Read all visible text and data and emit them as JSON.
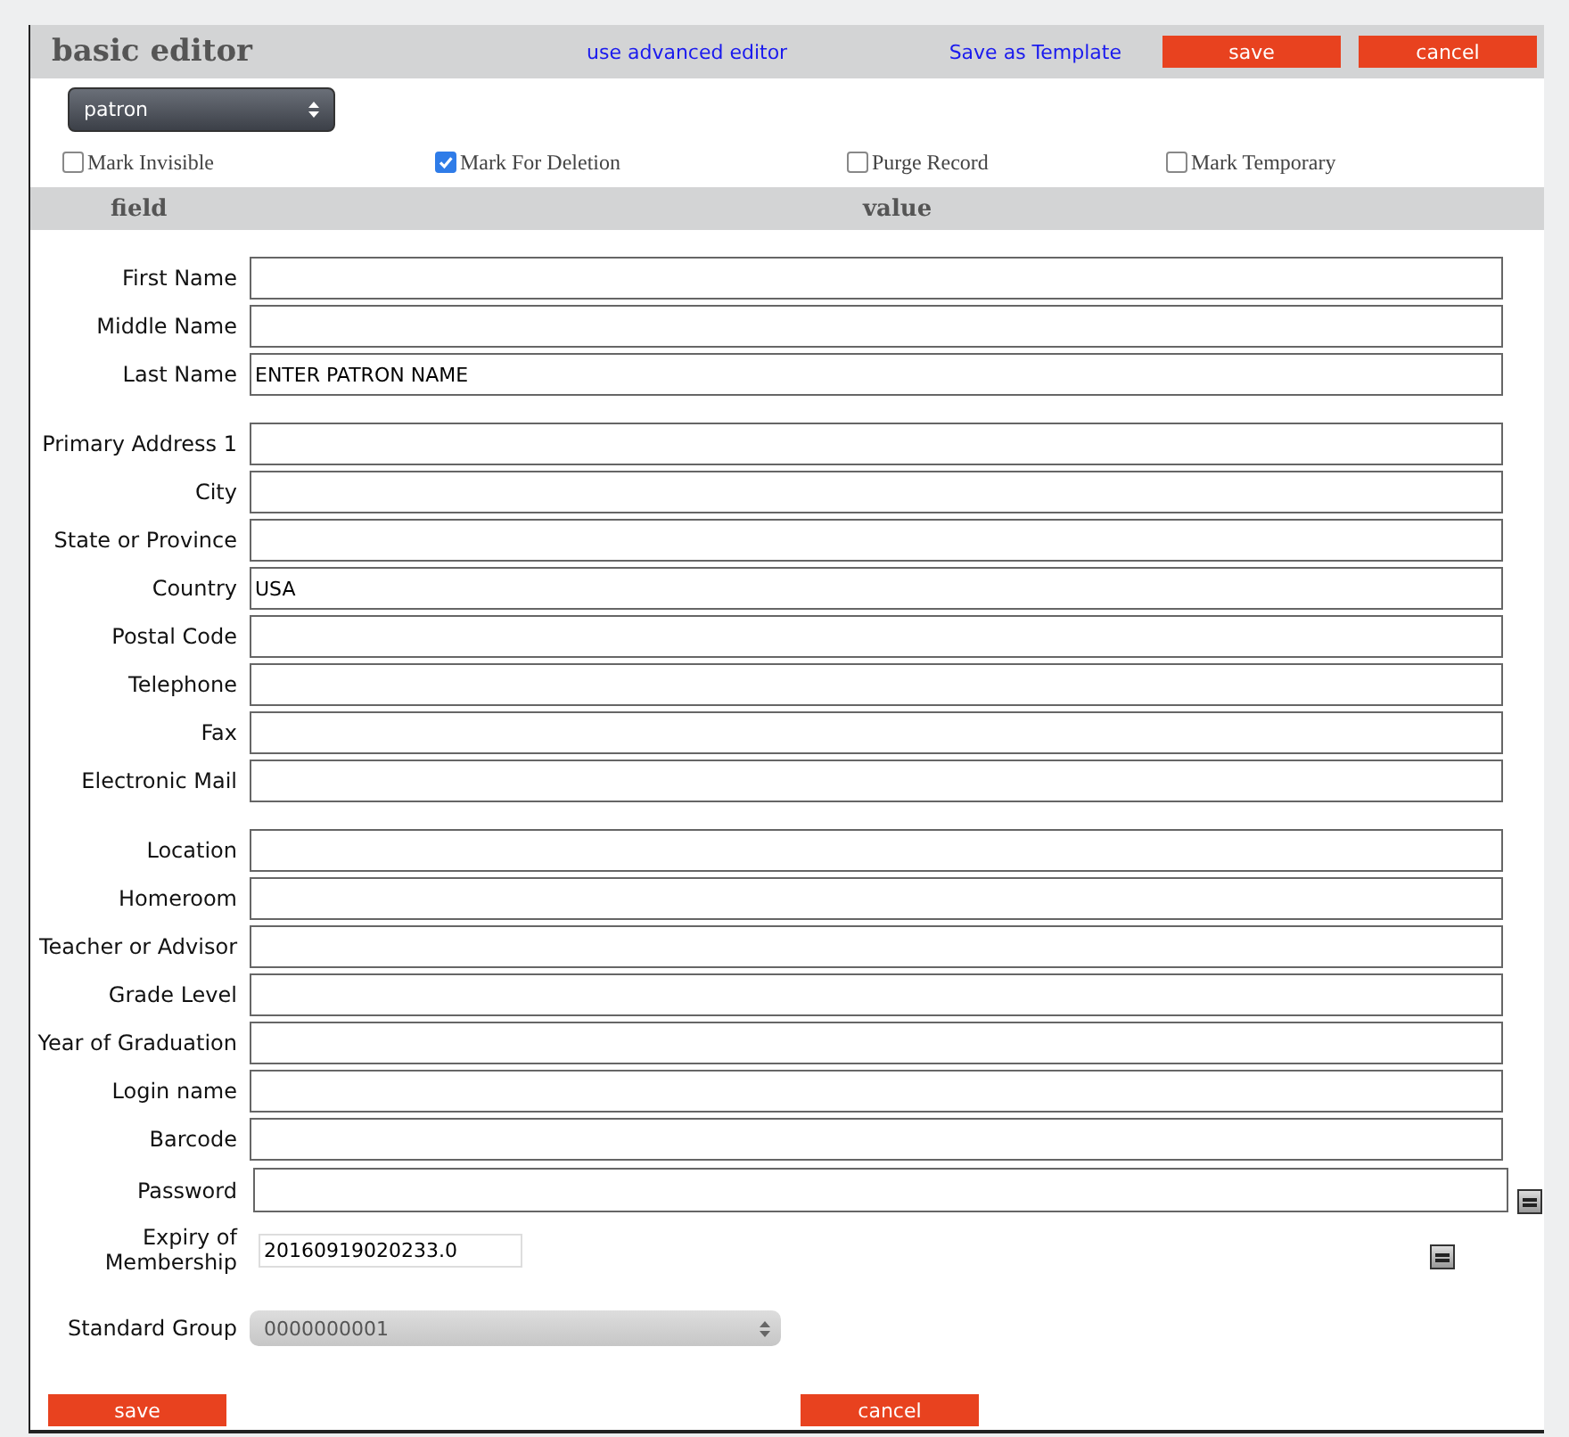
{
  "header": {
    "title": "basic editor",
    "advanced_link": "use advanced editor",
    "template_link": "Save as Template",
    "save": "save",
    "cancel": "cancel"
  },
  "record_type": "patron",
  "flags": [
    {
      "label": "Mark Invisible",
      "checked": false
    },
    {
      "label": "Mark For Deletion",
      "checked": true
    },
    {
      "label": "Purge Record",
      "checked": false
    },
    {
      "label": "Mark Temporary",
      "checked": false
    }
  ],
  "columns": [
    "field",
    "value"
  ],
  "groups": [
    [
      {
        "label": "First Name",
        "kind": "text"
      },
      {
        "label": "Middle Name",
        "kind": "text"
      },
      {
        "label": "Last Name",
        "kind": "text",
        "value": "ENTER PATRON NAME"
      }
    ],
    [
      {
        "label": "Primary Address 1",
        "kind": "text"
      },
      {
        "label": "City",
        "kind": "text"
      },
      {
        "label": "State or Province",
        "kind": "text"
      },
      {
        "label": "Country",
        "kind": "text",
        "value": "USA"
      },
      {
        "label": "Postal Code",
        "kind": "text"
      },
      {
        "label": "Telephone",
        "kind": "text"
      },
      {
        "label": "Fax",
        "kind": "text"
      },
      {
        "label": "Electronic Mail",
        "kind": "text"
      }
    ],
    [
      {
        "label": "Location",
        "kind": "text"
      },
      {
        "label": "Homeroom",
        "kind": "text"
      },
      {
        "label": "Teacher or Advisor",
        "kind": "text"
      },
      {
        "label": "Grade Level",
        "kind": "text"
      },
      {
        "label": "Year of Graduation",
        "kind": "text"
      },
      {
        "label": "Login name",
        "kind": "text"
      },
      {
        "label": "Barcode",
        "kind": "text"
      },
      {
        "label": "Password",
        "kind": "password"
      },
      {
        "label": "Expiry of Membership",
        "kind": "date",
        "value": "20160919020233.0"
      }
    ],
    [
      {
        "label": "Standard Group",
        "kind": "select",
        "value": "0000000001"
      }
    ]
  ],
  "footer": {
    "save": "save",
    "cancel": "cancel"
  }
}
